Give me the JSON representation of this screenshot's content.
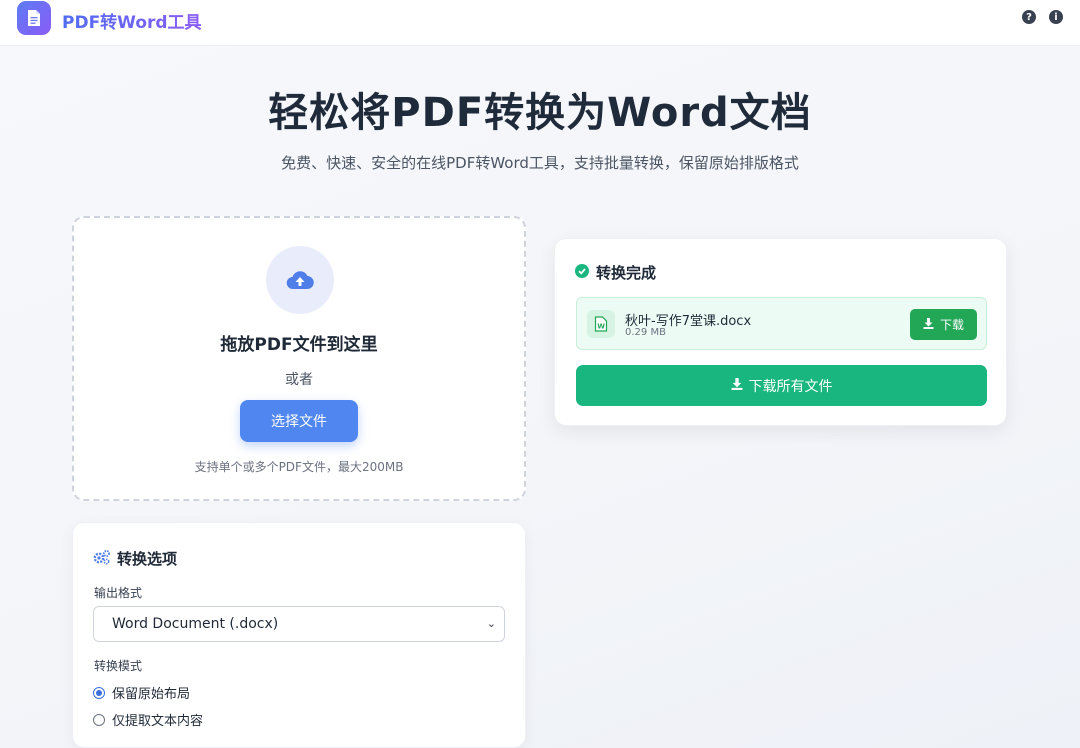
{
  "header": {
    "brand": "PDF转Word工具",
    "logo_icon": "document-icon",
    "help_icon": "question-icon",
    "info_icon": "info-icon"
  },
  "hero": {
    "title": "轻松将PDF转换为Word文档",
    "subtitle": "免费、快速、安全的在线PDF转Word工具，支持批量转换，保留原始排版格式"
  },
  "upload": {
    "icon": "cloud-upload-icon",
    "title": "拖放PDF文件到这里",
    "or_text": "或者",
    "button_label": "选择文件",
    "hint": "支持单个或多个PDF文件，最大200MB"
  },
  "options": {
    "icon": "gears-icon",
    "title": "转换选项",
    "format_label": "输出格式",
    "format_value": "Word Document (.docx)",
    "mode_label": "转换模式",
    "modes": [
      {
        "label": "保留原始布局",
        "selected": true
      },
      {
        "label": "仅提取文本内容",
        "selected": false
      }
    ]
  },
  "result": {
    "icon": "check-circle-icon",
    "title": "转换完成",
    "files": [
      {
        "name": "秋叶-写作7堂课.docx",
        "size": "0.29 MB",
        "icon": "word-file-icon",
        "download_label": "下载"
      }
    ],
    "download_all_label": "下载所有文件"
  },
  "colors": {
    "primary": "#4f86f0",
    "success": "#19b67f",
    "download": "#22a757",
    "brand_start": "#4f6df0",
    "brand_end": "#8b5cf6"
  }
}
